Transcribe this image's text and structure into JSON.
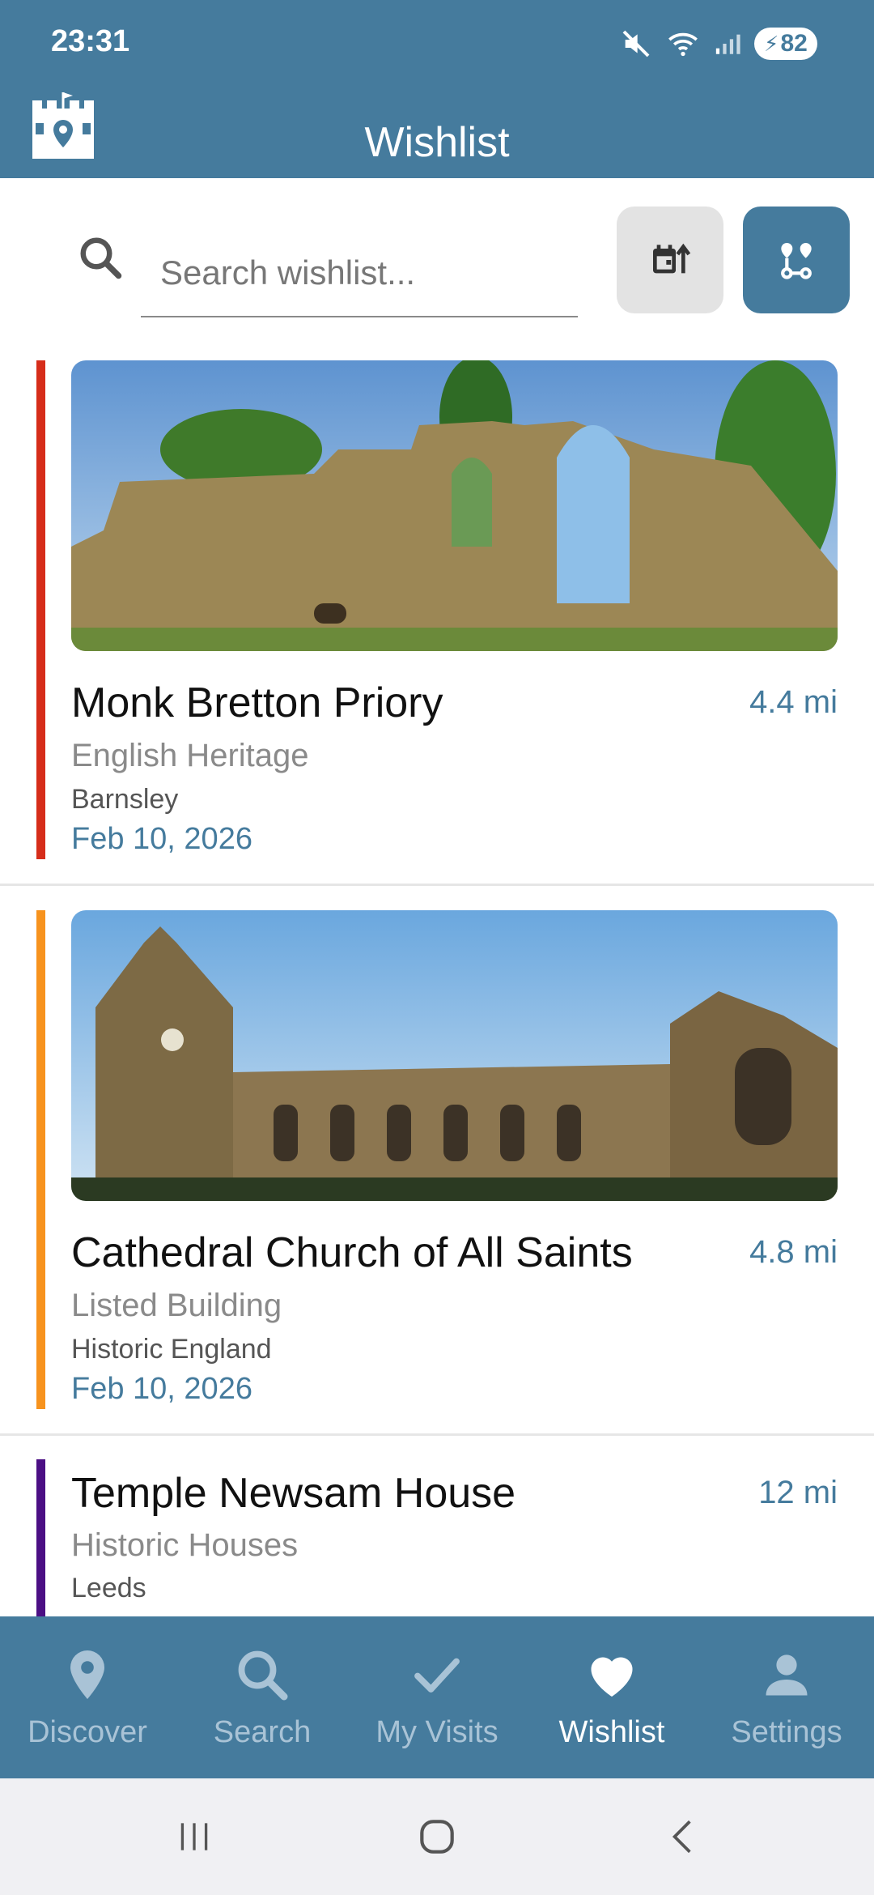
{
  "status": {
    "time": "23:31",
    "battery": "82"
  },
  "header": {
    "title": "Wishlist"
  },
  "search": {
    "placeholder": "Search wishlist..."
  },
  "colors": {
    "brand": "#457b9d",
    "accent_red": "#d62d1a",
    "accent_orange": "#f7931e",
    "accent_purple": "#4b0f84"
  },
  "items": [
    {
      "name": "Monk Bretton Priory",
      "distance": "4.4 mi",
      "category": "English Heritage",
      "location": "Barnsley",
      "date": "Feb 10, 2026"
    },
    {
      "name": "Cathedral Church of All Saints",
      "distance": "4.8 mi",
      "category": "Listed Building",
      "location": "Historic England",
      "date": "Feb 10, 2026"
    },
    {
      "name": "Temple Newsam House",
      "distance": "12 mi",
      "category": "Historic Houses",
      "location": "Leeds"
    }
  ],
  "nav": [
    {
      "label": "Discover",
      "icon": "map-pin-icon"
    },
    {
      "label": "Search",
      "icon": "search-icon"
    },
    {
      "label": "My Visits",
      "icon": "checkmark-icon"
    },
    {
      "label": "Wishlist",
      "icon": "heart-icon",
      "active": true
    },
    {
      "label": "Settings",
      "icon": "person-icon"
    }
  ]
}
